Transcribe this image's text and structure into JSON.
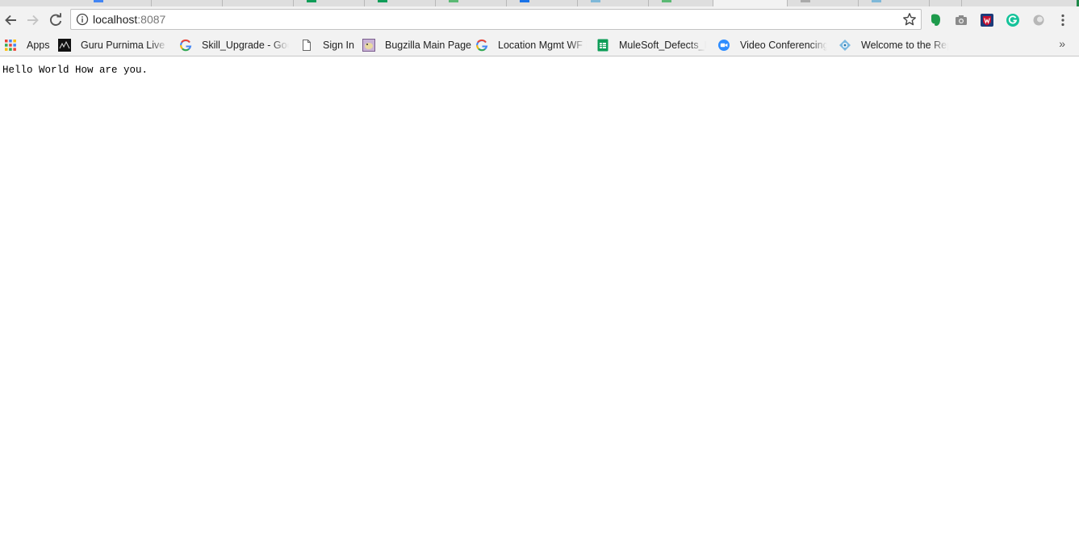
{
  "browser": {
    "address_host": "localhost",
    "address_port": ":8087",
    "bookmarks": [
      {
        "label": "Apps",
        "icon": "apps-grid-icon"
      },
      {
        "label": "Guru Purnima Live st",
        "icon": "guru-purnima-icon"
      },
      {
        "label": "Skill_Upgrade - Goo",
        "icon": "google-g-icon"
      },
      {
        "label": "Sign In",
        "icon": "page-icon"
      },
      {
        "label": "Bugzilla Main Page",
        "icon": "bugzilla-icon"
      },
      {
        "label": "Location Mgmt WF F",
        "icon": "google-g-icon"
      },
      {
        "label": "MuleSoft_Defects_Kr",
        "icon": "sheets-icon"
      },
      {
        "label": "Video Conferencing,",
        "icon": "zoom-icon"
      },
      {
        "label": "Welcome to the Rep",
        "icon": "report-portal-icon"
      }
    ],
    "overflow_label": "»",
    "extensions": [
      "evernote-icon",
      "camera-icon",
      "mcafee-icon",
      "grammarly-icon",
      "extension-circle-icon"
    ]
  },
  "page": {
    "body_text": "Hello World How are you."
  },
  "colors": {
    "chrome_bg": "#f2f2f2",
    "tab_strip": "#dedede",
    "accent_green": "#1f8a49"
  }
}
